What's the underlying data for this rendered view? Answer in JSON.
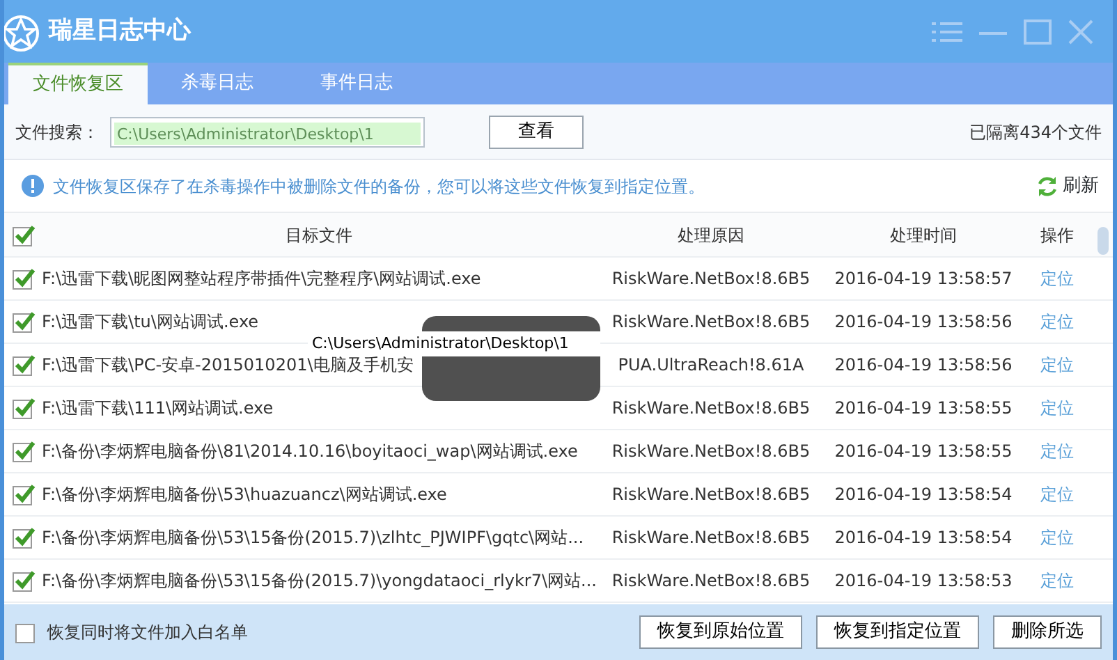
{
  "window": {
    "title": "瑞星日志中心"
  },
  "tabs": [
    {
      "label": "文件恢复区",
      "selected": true
    },
    {
      "label": "杀毒日志",
      "selected": false
    },
    {
      "label": "事件日志",
      "selected": false
    }
  ],
  "search": {
    "label": "文件搜索：",
    "value": "C:\\Users\\Administrator\\Desktop\\1",
    "button": "查看",
    "count": "已隔离434个文件"
  },
  "info": {
    "text": "文件恢复区保存了在杀毒操作中被删除文件的备份，您可以将这些文件恢复到指定位置。",
    "refresh": "刷新"
  },
  "table": {
    "all_checked": true,
    "columns": [
      "目标文件",
      "处理原因",
      "处理时间",
      "操作"
    ],
    "rows": [
      {
        "checked": true,
        "file": "F:\\迅雷下载\\昵图网整站程序带插件\\完整程序\\网站调试.exe",
        "reason": "RiskWare.NetBox!8.6B5",
        "time": "2016-04-19 13:58:57",
        "action": "定位"
      },
      {
        "checked": true,
        "file": "F:\\迅雷下载\\tu\\网站调试.exe",
        "reason": "RiskWare.NetBox!8.6B5",
        "time": "2016-04-19 13:58:56",
        "action": "定位"
      },
      {
        "checked": true,
        "file": "F:\\迅雷下载\\PC-安卓-2015010201\\电脑及手机安",
        "reason": "PUA.UltraReach!8.61A",
        "time": "2016-04-19 13:58:56",
        "action": "定位"
      },
      {
        "checked": true,
        "file": "F:\\迅雷下载\\111\\网站调试.exe",
        "reason": "RiskWare.NetBox!8.6B5",
        "time": "2016-04-19 13:58:55",
        "action": "定位"
      },
      {
        "checked": true,
        "file": "F:\\备份\\李炳辉电脑备份\\81\\2014.10.16\\boyitaoci_wap\\网站调试.exe",
        "reason": "RiskWare.NetBox!8.6B5",
        "time": "2016-04-19 13:58:55",
        "action": "定位"
      },
      {
        "checked": true,
        "file": "F:\\备份\\李炳辉电脑备份\\53\\huazuancz\\网站调试.exe",
        "reason": "RiskWare.NetBox!8.6B5",
        "time": "2016-04-19 13:58:54",
        "action": "定位"
      },
      {
        "checked": true,
        "file": "F:\\备份\\李炳辉电脑备份\\53\\15备份(2015.7)\\zlhtc_PJWIPF\\gqtc\\网站...",
        "reason": "RiskWare.NetBox!8.6B5",
        "time": "2016-04-19 13:58:54",
        "action": "定位"
      },
      {
        "checked": true,
        "file": "F:\\备份\\李炳辉电脑备份\\53\\15备份(2015.7)\\yongdataoci_rlykr7\\网站...",
        "reason": "RiskWare.NetBox!8.6B5",
        "time": "2016-04-19 13:58:53",
        "action": "定位"
      }
    ]
  },
  "tooltip": {
    "text": "C:\\Users\\Administrator\\Desktop\\1"
  },
  "footer": {
    "whitelist": {
      "label": "恢复同时将文件加入白名单",
      "checked": false
    },
    "buttons": [
      "恢复到原始位置",
      "恢复到指定位置",
      "删除所选"
    ]
  }
}
